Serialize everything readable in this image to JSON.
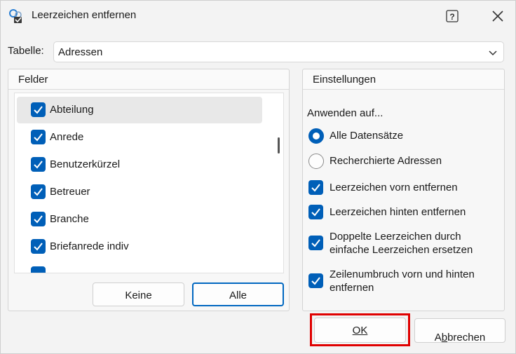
{
  "window": {
    "title": "Leerzeichen entfernen",
    "help_glyph": "?",
    "close_glyph": "✕"
  },
  "table": {
    "label": "Tabelle:",
    "value": "Adressen"
  },
  "fields": {
    "group_title": "Felder",
    "items": [
      {
        "label": "Abteilung",
        "checked": true,
        "selected": true
      },
      {
        "label": "Anrede",
        "checked": true
      },
      {
        "label": "Benutzerkürzel",
        "checked": true
      },
      {
        "label": "Betreuer",
        "checked": true
      },
      {
        "label": "Branche",
        "checked": true
      },
      {
        "label": "Briefanrede indiv",
        "checked": true
      }
    ],
    "none_button": "Keine",
    "all_button": "Alle"
  },
  "settings": {
    "group_title": "Einstellungen",
    "apply_label": "Anwenden auf...",
    "radio_all": "Alle Datensätze",
    "radio_searched": "Recherchierte Adressen",
    "opt_front": "Leerzeichen vorn entfernen",
    "opt_back": "Leerzeichen hinten entfernen",
    "opt_double_1": "Doppelte Leerzeichen durch",
    "opt_double_2": "einfache Leerzeichen ersetzen",
    "opt_linebreak_1": "Zeilenumbruch vorn und hinten",
    "opt_linebreak_2": "entfernen"
  },
  "footer": {
    "ok_label": "OK",
    "cancel_prefix": "A",
    "cancel_underlined": "b",
    "cancel_suffix": "brechen"
  },
  "colors": {
    "accent": "#005fb8",
    "highlight": "#e00000"
  }
}
